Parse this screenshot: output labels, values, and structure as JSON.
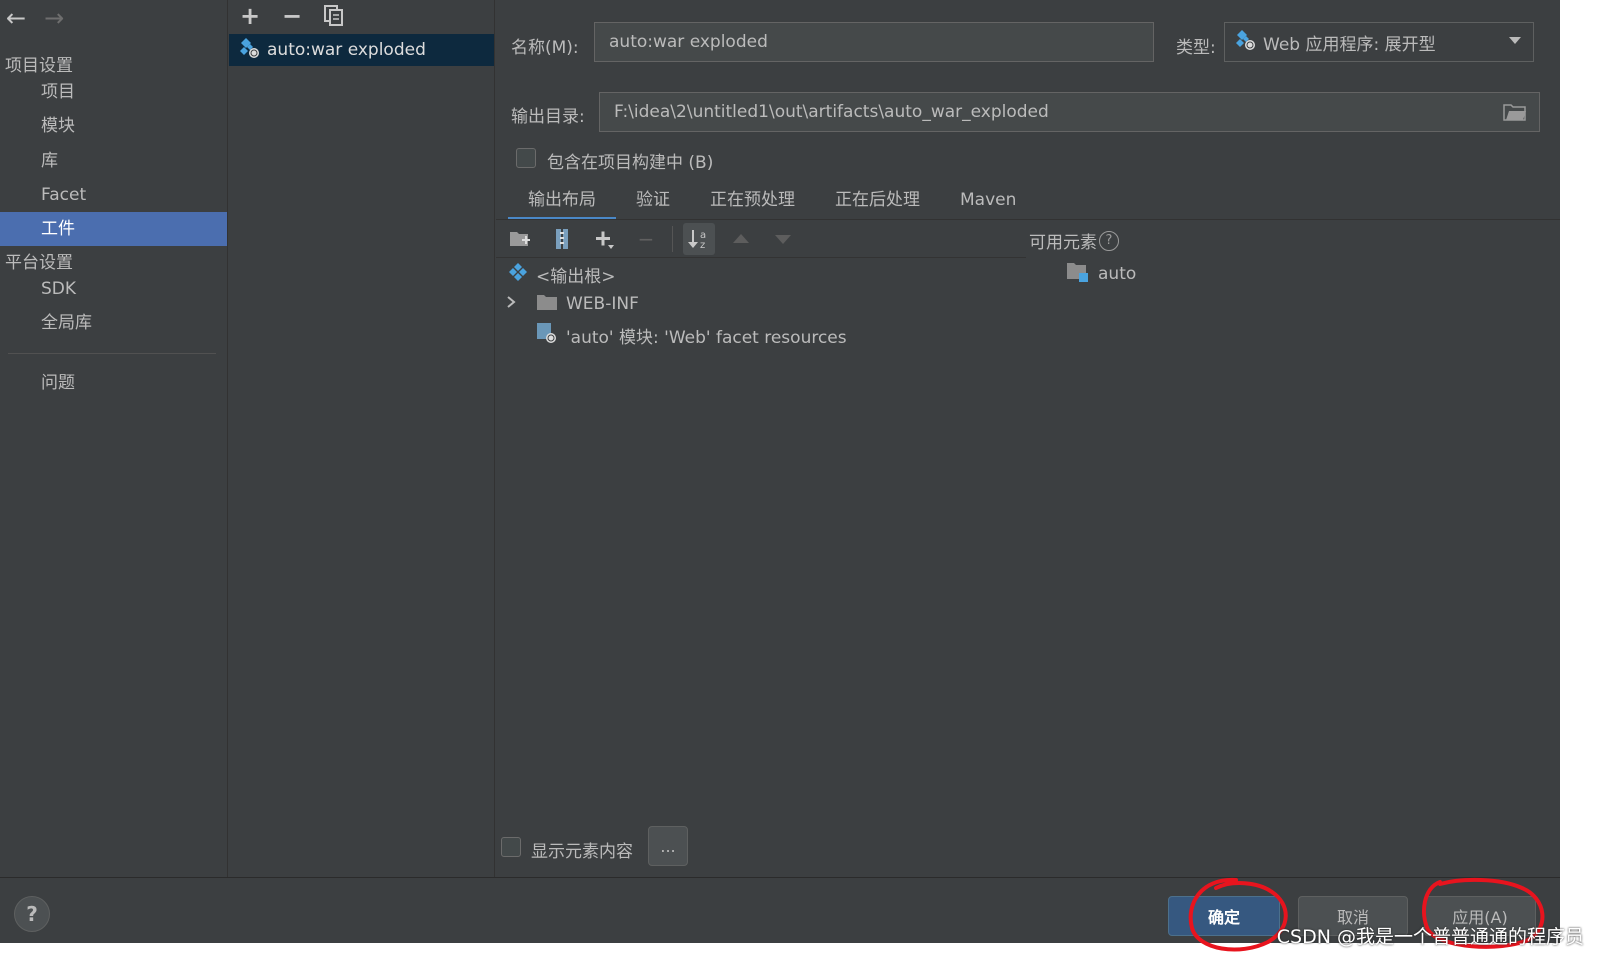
{
  "sidebar": {
    "project_settings_header": "项目设置",
    "project_items": [
      {
        "label": "项目"
      },
      {
        "label": "模块"
      },
      {
        "label": "库"
      },
      {
        "label": "Facet"
      },
      {
        "label": "工件"
      }
    ],
    "platform_settings_header": "平台设置",
    "platform_items": [
      {
        "label": "SDK"
      },
      {
        "label": "全局库"
      }
    ],
    "problems_label": "问题",
    "selected": "工件"
  },
  "artifacts": {
    "items": [
      {
        "label": "auto:war exploded"
      }
    ]
  },
  "detail": {
    "name_label": "名称(M):",
    "name_value": "auto:war exploded",
    "type_label": "类型:",
    "type_value": "Web 应用程序: 展开型",
    "output_dir_label": "输出目录:",
    "output_dir_value": "F:\\idea\\2\\untitled1\\out\\artifacts\\auto_war_exploded",
    "include_in_build_label": "包含在项目构建中 (B)",
    "include_in_build_checked": false,
    "tabs": [
      {
        "label": "输出布局"
      },
      {
        "label": "验证"
      },
      {
        "label": "正在预处理"
      },
      {
        "label": "正在后处理"
      },
      {
        "label": "Maven"
      }
    ],
    "active_tab": "输出布局",
    "tree": {
      "root": "<输出根>",
      "web_inf": "WEB-INF",
      "facet_resources": "'auto' 模块: 'Web' facet resources"
    },
    "available_elements_title": "可用元素",
    "available_help": "?",
    "available_items": [
      {
        "label": "auto"
      }
    ],
    "show_content_label": "显示元素内容",
    "more_button": "..."
  },
  "footer": {
    "help": "?",
    "ok": "确定",
    "cancel": "取消",
    "apply": "应用(A)"
  },
  "watermark": "CSDN @我是一个普普通通的程序员",
  "colors": {
    "background": "#3c3f41",
    "selection": "#4b6eaf",
    "list_selection": "#0d293e",
    "primary_button": "#365880",
    "annotation": "#e8141e"
  }
}
